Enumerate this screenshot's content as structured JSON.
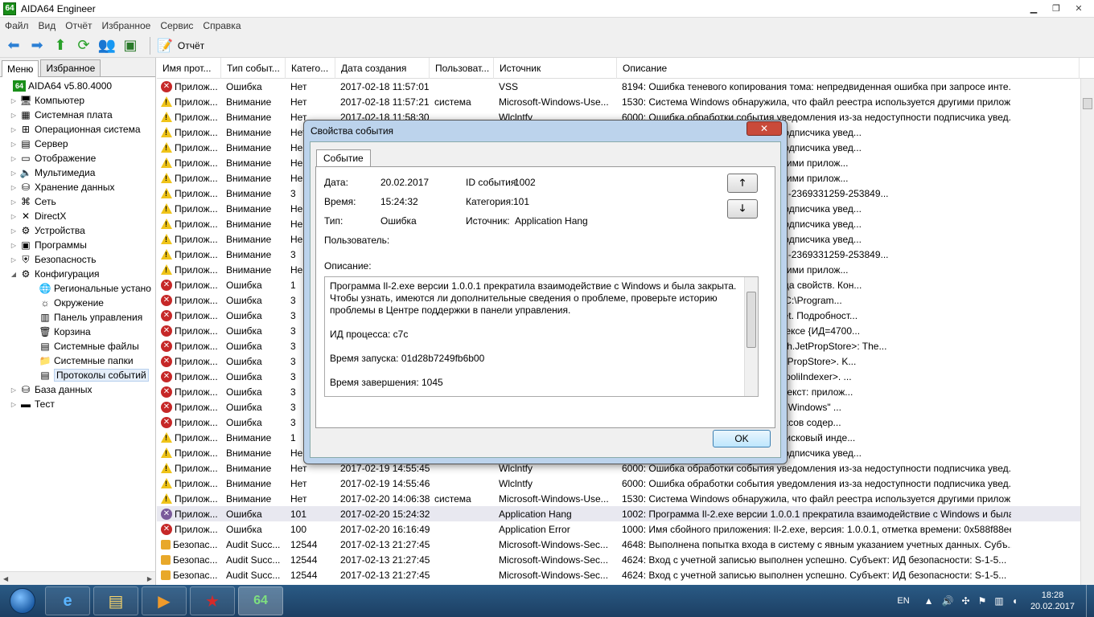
{
  "window": {
    "title": "AIDA64 Engineer",
    "app_icon": "64"
  },
  "menu": [
    "Файл",
    "Вид",
    "Отчёт",
    "Избранное",
    "Сервис",
    "Справка"
  ],
  "toolbar": {
    "report_label": "Отчёт"
  },
  "left_panel": {
    "tabs": [
      "Меню",
      "Избранное"
    ],
    "tree": [
      {
        "label": "AIDA64 v5.80.4000",
        "icon": "aida64-icon",
        "exp": "",
        "indent": 0
      },
      {
        "label": "Компьютер",
        "icon": "computer-icon",
        "exp": "▷",
        "indent": 1
      },
      {
        "label": "Системная плата",
        "icon": "motherboard-icon",
        "exp": "▷",
        "indent": 1
      },
      {
        "label": "Операционная система",
        "icon": "windows-icon",
        "exp": "▷",
        "indent": 1
      },
      {
        "label": "Сервер",
        "icon": "server-icon",
        "exp": "▷",
        "indent": 1
      },
      {
        "label": "Отображение",
        "icon": "display-icon",
        "exp": "▷",
        "indent": 1
      },
      {
        "label": "Мультимедиа",
        "icon": "speaker-icon",
        "exp": "▷",
        "indent": 1
      },
      {
        "label": "Хранение данных",
        "icon": "storage-icon",
        "exp": "▷",
        "indent": 1
      },
      {
        "label": "Сеть",
        "icon": "network-icon",
        "exp": "▷",
        "indent": 1
      },
      {
        "label": "DirectX",
        "icon": "directx-icon",
        "exp": "▷",
        "indent": 1
      },
      {
        "label": "Устройства",
        "icon": "devices-icon",
        "exp": "▷",
        "indent": 1
      },
      {
        "label": "Программы",
        "icon": "programs-icon",
        "exp": "▷",
        "indent": 1
      },
      {
        "label": "Безопасность",
        "icon": "security-icon",
        "exp": "▷",
        "indent": 1
      },
      {
        "label": "Конфигурация",
        "icon": "config-icon",
        "exp": "◢",
        "indent": 1
      },
      {
        "label": "Региональные устано",
        "icon": "regional-icon",
        "exp": "",
        "indent": 2
      },
      {
        "label": "Окружение",
        "icon": "environment-icon",
        "exp": "",
        "indent": 2
      },
      {
        "label": "Панель управления",
        "icon": "control-panel-icon",
        "exp": "",
        "indent": 2
      },
      {
        "label": "Корзина",
        "icon": "recycle-bin-icon",
        "exp": "",
        "indent": 2
      },
      {
        "label": "Системные файлы",
        "icon": "system-files-icon",
        "exp": "",
        "indent": 2
      },
      {
        "label": "Системные папки",
        "icon": "folder-icon",
        "exp": "",
        "indent": 2
      },
      {
        "label": "Протоколы событий",
        "icon": "event-log-icon",
        "exp": "",
        "indent": 2,
        "selected": true
      },
      {
        "label": "База данных",
        "icon": "database-icon",
        "exp": "▷",
        "indent": 1
      },
      {
        "label": "Тест",
        "icon": "test-icon",
        "exp": "▷",
        "indent": 1
      }
    ]
  },
  "table": {
    "headers": [
      "Имя прот...",
      "Тип событ...",
      "Катего...",
      "Дата создания",
      "Пользоват...",
      "Источник",
      "Описание"
    ],
    "rows": [
      {
        "s": "err",
        "c": [
          "Прилож...",
          "Ошибка",
          "Нет",
          "2017-02-18 11:57:01",
          "",
          "VSS",
          "8194: Ошибка теневого копирования тома: непредвиденная ошибка при запросе инте..."
        ]
      },
      {
        "s": "warn",
        "c": [
          "Прилож...",
          "Внимание",
          "Нет",
          "2017-02-18 11:57:21",
          "система",
          "Microsoft-Windows-Use...",
          "1530: Система Windows обнаружила, что файл реестра используется другими прилож..."
        ]
      },
      {
        "s": "warn",
        "c": [
          "Прилож...",
          "Внимание",
          "Нет",
          "2017-02-18 11:58:30",
          "",
          "Wlclntfy",
          "6000: Ошибка обработки события уведомления из-за недоступности подписчика увед..."
        ]
      },
      {
        "s": "warn",
        "c": [
          "Прилож...",
          "Внимание",
          "Нет",
          "",
          "",
          "",
          "уведомления из-за недоступности подписчика увед..."
        ]
      },
      {
        "s": "warn",
        "c": [
          "Прилож...",
          "Внимание",
          "Не",
          "",
          "",
          "",
          "уведомления из-за недоступности подписчика увед..."
        ]
      },
      {
        "s": "warn",
        "c": [
          "Прилож...",
          "Внимание",
          "Не",
          "",
          "",
          "",
          "что файл реестра используется другими прилож..."
        ]
      },
      {
        "s": "warn",
        "c": [
          "Прилож...",
          "Внимание",
          "Не",
          "",
          "",
          "",
          "что файл реестра используется другими прилож..."
        ]
      },
      {
        "s": "warn",
        "c": [
          "Прилож...",
          "Внимание",
          "3",
          "",
          "",
          "",
          "ID прото <csc://{S-1-5-21-2494541902-2369331259-253849..."
        ]
      },
      {
        "s": "warn",
        "c": [
          "Прилож...",
          "Внимание",
          "Не",
          "",
          "",
          "",
          "уведомления из-за недоступности подписчика увед..."
        ]
      },
      {
        "s": "warn",
        "c": [
          "Прилож...",
          "Внимание",
          "Не",
          "",
          "",
          "",
          "уведомления из-за недоступности подписчика увед..."
        ]
      },
      {
        "s": "warn",
        "c": [
          "Прилож...",
          "Внимание",
          "Не",
          "",
          "",
          "",
          "уведомления из-за недоступности подписчика увед..."
        ]
      },
      {
        "s": "warn",
        "c": [
          "Прилож...",
          "Внимание",
          "3",
          "",
          "",
          "",
          "ID прото <csc://{S-1-5-21-2494541902-2369331259-253849..."
        ]
      },
      {
        "s": "warn",
        "c": [
          "Прилож...",
          "Внимание",
          "Не",
          "",
          "",
          "",
          "что файл реестра используется другими прилож..."
        ]
      },
      {
        "s": "err",
        "c": [
          "Прилож...",
          "Ошибка",
          "1",
          "",
          "",
          "",
          "ается загрузить данные из хранилища свойств.  Кон..."
        ]
      },
      {
        "s": "err",
        "c": [
          "Прилож...",
          "Ошибка",
          "3",
          "",
          "",
          "",
          "-1811 при открытии файла журнала C:\\Program..."
        ]
      },
      {
        "s": "err",
        "c": [
          "Прилож...",
          "Ошибка",
          "3",
          "",
          "",
          "",
          "ается открыть хранилище свойств Jet.  Подробност..."
        ]
      },
      {
        "s": "err",
        "c": [
          "Прилож...",
          "Ошибка",
          "3",
          "",
          "",
          "",
          "поврежденные файлы данных в индексе {ИД=4700..."
        ]
      },
      {
        "s": "err",
        "c": [
          "Прилож...",
          "Ошибка",
          "3",
          "",
          "",
          "",
          "остановлена из-за проблем с <Search.JetPropStore>: The..."
        ]
      },
      {
        "s": "err",
        "c": [
          "Прилож...",
          "Ошибка",
          "3",
          "",
          "",
          "",
          "подключаемый модуль в <Search.JetPropStore>.  K..."
        ]
      },
      {
        "s": "err",
        "c": [
          "Прилож...",
          "Ошибка",
          "3",
          "",
          "",
          "",
          "подключаемый модуль в <Search.TripoliIndexer>.  ..."
        ]
      },
      {
        "s": "err",
        "c": [
          "Прилож...",
          "Ошибка",
          "3",
          "",
          "",
          "",
          "объект средства сбора данных.  Контекст: прилож..."
        ]
      },
      {
        "s": "err",
        "c": [
          "Прилож...",
          "Ошибка",
          "3",
          "",
          "",
          "",
          "приложение.  Контекст: приложение \"Windows\"  ..."
        ]
      },
      {
        "s": "err",
        "c": [
          "Прилож...",
          "Ошибка",
          "3",
          "",
          "",
          "",
          "каталог.  Подробности:  Каталог индексов содер..."
        ]
      },
      {
        "s": "warn",
        "c": [
          "Прилож...",
          "Внимание",
          "1",
          "",
          "",
          "",
          "ается и пытается удалить старый поисковый инде..."
        ]
      },
      {
        "s": "warn",
        "c": [
          "Прилож...",
          "Внимание",
          "Не",
          "",
          "",
          "",
          "уведомления из-за недоступности подписчика увед..."
        ]
      },
      {
        "s": "warn",
        "c": [
          "Прилож...",
          "Внимание",
          "Нет",
          "2017-02-19 14:55:45",
          "",
          "Wlclntfy",
          "6000: Ошибка обработки события уведомления из-за недоступности подписчика увед..."
        ]
      },
      {
        "s": "warn",
        "c": [
          "Прилож...",
          "Внимание",
          "Нет",
          "2017-02-19 14:55:46",
          "",
          "Wlclntfy",
          "6000: Ошибка обработки события уведомления из-за недоступности подписчика увед..."
        ]
      },
      {
        "s": "warn",
        "c": [
          "Прилож...",
          "Внимание",
          "Нет",
          "2017-02-20 14:06:38",
          "система",
          "Microsoft-Windows-Use...",
          "1530: Система Windows обнаружила, что файл реестра используется другими прилож..."
        ]
      },
      {
        "s": "hang",
        "c": [
          "Прилож...",
          "Ошибка",
          "101",
          "2017-02-20 15:24:32",
          "",
          "Application Hang",
          "1002: Программа Il-2.exe версии 1.0.0.1 прекратила взаимодействие с Windows и была ..."
        ],
        "h": true
      },
      {
        "s": "err",
        "c": [
          "Прилож...",
          "Ошибка",
          "100",
          "2017-02-20 16:16:49",
          "",
          "Application Error",
          "1000: Имя сбойного приложения: Il-2.exe, версия: 1.0.0.1, отметка времени: 0x588f88ee ..."
        ]
      },
      {
        "s": "lock",
        "c": [
          "Безопас...",
          "Audit Succ...",
          "12544",
          "2017-02-13 21:27:45",
          "",
          "Microsoft-Windows-Sec...",
          "4648: Выполнена попытка входа в систему с явным указанием учетных данных.   Субъ..."
        ]
      },
      {
        "s": "lock",
        "c": [
          "Безопас...",
          "Audit Succ...",
          "12544",
          "2017-02-13 21:27:45",
          "",
          "Microsoft-Windows-Sec...",
          "4624: Вход с учетной записью выполнен успешно.    Субъект:    ИД безопасности:  S-1-5..."
        ]
      },
      {
        "s": "lock",
        "c": [
          "Безопас...",
          "Audit Succ...",
          "12544",
          "2017-02-13 21:27:45",
          "",
          "Microsoft-Windows-Sec...",
          "4624: Вход с учетной записью выполнен успешно.    Субъект:    ИД безопасности:  S-1-5..."
        ]
      }
    ]
  },
  "dialog": {
    "title": "Свойства события",
    "tab": "Событие",
    "date_label": "Дата:",
    "date_value": "20.02.2017",
    "event_id_label": "ID события:",
    "event_id_value": "1002",
    "time_label": "Время:",
    "time_value": "15:24:32",
    "category_label": "Категория:",
    "category_value": "101",
    "type_label": "Тип:",
    "type_value": "Ошибка",
    "source_label": "Источник:",
    "source_value": "Application Hang",
    "user_label": "Пользователь:",
    "description_label": "Описание:",
    "description": [
      "Программа Il-2.exe версии 1.0.0.1 прекратила взаимодействие с Windows и была закрыта. Чтобы узнать, имеются ли дополнительные сведения о проблеме, проверьте историю проблемы в Центре поддержки в панели управления.",
      "ИД процесса: c7c",
      "Время запуска: 01d28b7249fb6b00",
      "Время завершения: 1045"
    ],
    "ok_label": "OK"
  },
  "taskbar": {
    "lang": "EN",
    "time": "18:28",
    "date": "20.02.2017"
  }
}
